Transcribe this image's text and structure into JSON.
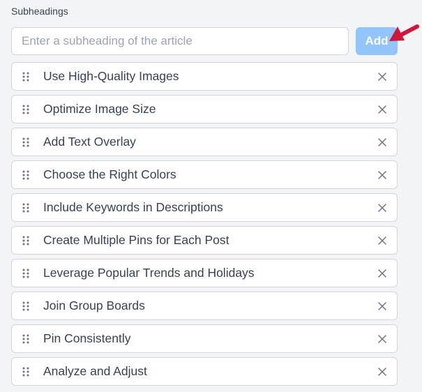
{
  "section": {
    "label": "Subheadings"
  },
  "add_form": {
    "placeholder": "Enter a subheading of the article",
    "value": "",
    "button_label": "Add",
    "button_color": "#93c5fd"
  },
  "annotation": {
    "arrow_color": "#d0163a"
  },
  "icons": {
    "drag": "drag-handle-icon",
    "remove": "close-icon",
    "pointer": "arrow-pointer-icon"
  },
  "subheadings": [
    {
      "label": "Use High-Quality Images"
    },
    {
      "label": "Optimize Image Size"
    },
    {
      "label": "Add Text Overlay"
    },
    {
      "label": "Choose the Right Colors"
    },
    {
      "label": "Include Keywords in Descriptions"
    },
    {
      "label": "Create Multiple Pins for Each Post"
    },
    {
      "label": "Leverage Popular Trends and Holidays"
    },
    {
      "label": "Join Group Boards"
    },
    {
      "label": "Pin Consistently"
    },
    {
      "label": "Analyze and Adjust"
    }
  ]
}
